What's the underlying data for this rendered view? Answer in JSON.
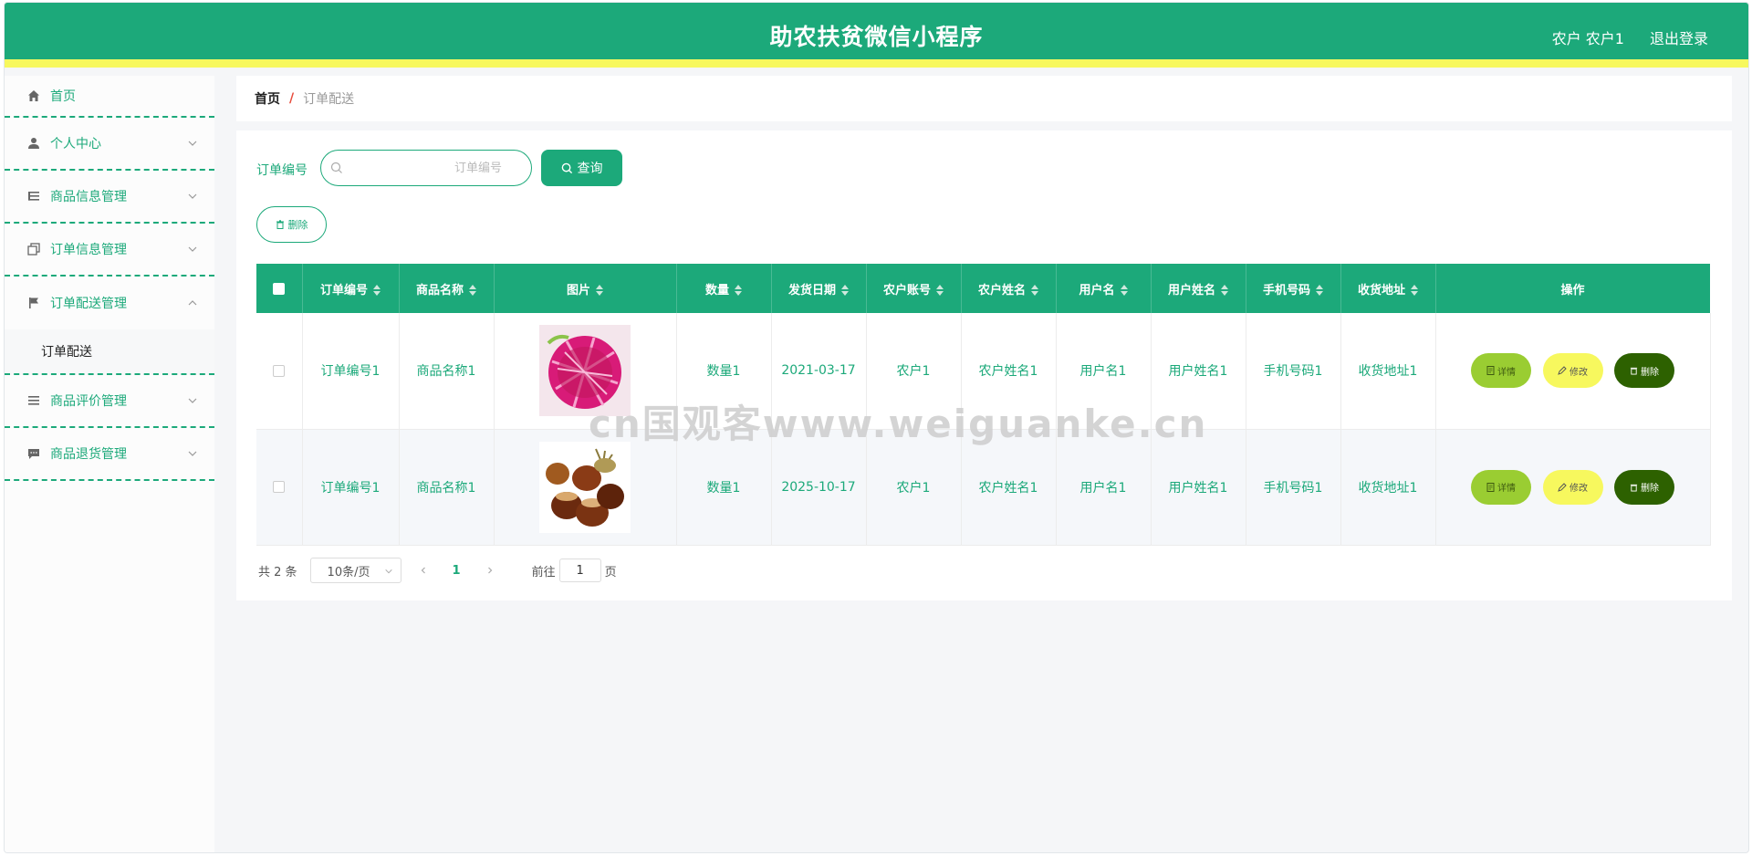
{
  "header": {
    "title": "助农扶贫微信小程序",
    "user": "农户 农户1",
    "logout": "退出登录"
  },
  "sidebar": {
    "items": [
      {
        "label": "首页",
        "icon": "home-icon"
      },
      {
        "label": "个人中心",
        "icon": "user-icon"
      },
      {
        "label": "商品信息管理",
        "icon": "list-icon"
      },
      {
        "label": "订单信息管理",
        "icon": "copy-icon"
      },
      {
        "label": "订单配送管理",
        "icon": "flag-icon",
        "expanded": true,
        "children": [
          {
            "label": "订单配送"
          }
        ]
      },
      {
        "label": "商品评价管理",
        "icon": "list-icon"
      },
      {
        "label": "商品退货管理",
        "icon": "chat-icon"
      }
    ]
  },
  "breadcrumb": {
    "home": "首页",
    "separator": "/",
    "current": "订单配送"
  },
  "search": {
    "label": "订单编号",
    "placeholder": "订单编号",
    "value": "",
    "query_label": "查询"
  },
  "toolbar": {
    "delete_label": "删除"
  },
  "table": {
    "columns": [
      "订单编号",
      "商品名称",
      "图片",
      "数量",
      "发货日期",
      "农户账号",
      "农户姓名",
      "用户名",
      "用户姓名",
      "手机号码",
      "收货地址",
      "操作"
    ],
    "rows": [
      {
        "order_no": "订单编号1",
        "product": "商品名称1",
        "image": "dragon-fruit",
        "qty": "数量1",
        "date": "2021-03-17",
        "farmer_account": "农户1",
        "farmer_name": "农户姓名1",
        "username": "用户名1",
        "user_name": "用户姓名1",
        "phone": "手机号码1",
        "address": "收货地址1"
      },
      {
        "order_no": "订单编号1",
        "product": "商品名称1",
        "image": "chestnuts",
        "qty": "数量1",
        "date": "2025-10-17",
        "farmer_account": "农户1",
        "farmer_name": "农户姓名1",
        "username": "用户名1",
        "user_name": "用户姓名1",
        "phone": "手机号码1",
        "address": "收货地址1"
      }
    ],
    "actions": {
      "detail": "详情",
      "edit": "修改",
      "delete": "删除"
    }
  },
  "pagination": {
    "total": "共 2 条",
    "page_size": "10条/页",
    "current_page": "1",
    "goto_prefix": "前往",
    "goto_value": "1",
    "goto_suffix": "页"
  },
  "watermark": "cn国观客www.weiguanke.cn",
  "colors": {
    "primary": "#1ca97a",
    "accent_yellow": "#f7f85e",
    "detail": "#9acd32",
    "delete": "#2d6100"
  }
}
